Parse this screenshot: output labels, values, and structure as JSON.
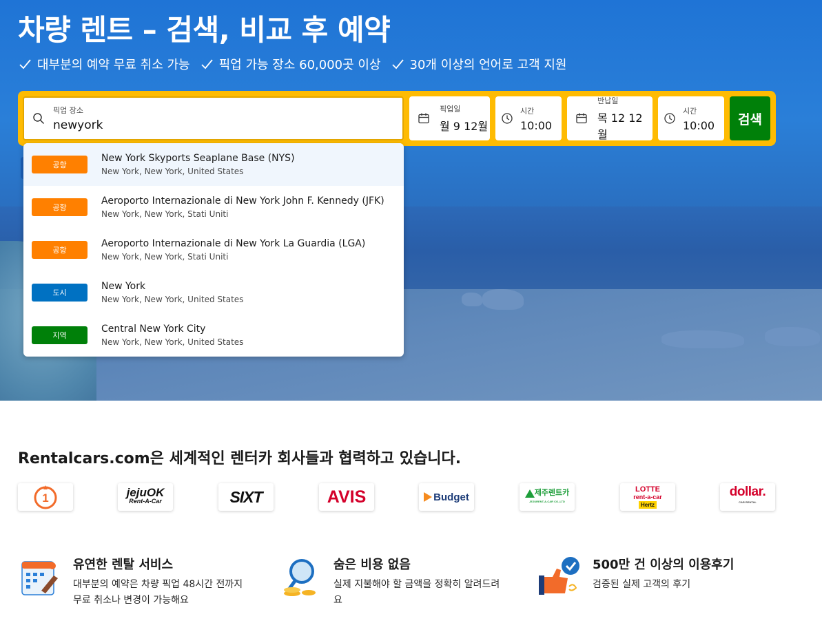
{
  "hero": {
    "title": "차량 렌트 – 검색, 비교 후 예약",
    "usps": [
      "대부분의 예약 무료 취소 가능",
      "픽업 가능 장소 60,000곳 이상",
      "30개 이상의 언어로 고객 지원"
    ]
  },
  "search": {
    "location_label": "픽업 장소",
    "location_value": "newyork",
    "pickup_date_label": "픽업일",
    "pickup_date_value": "월 9 12월",
    "pickup_time_label": "시간",
    "pickup_time_value": "10:00",
    "return_date_label": "반납일",
    "return_date_value": "목 12 12월",
    "return_time_label": "시간",
    "return_time_value": "10:00",
    "button_label": "검색"
  },
  "suggestions": [
    {
      "type": "공항",
      "color": "#ff8000",
      "name": "New York Skyports Seaplane Base (NYS)",
      "sub": "New York, New York, United States"
    },
    {
      "type": "공항",
      "color": "#ff8000",
      "name": "Aeroporto Internazionale di New York John F. Kennedy (JFK)",
      "sub": "New York, New York, Stati Uniti"
    },
    {
      "type": "공항",
      "color": "#ff8000",
      "name": "Aeroporto Internazionale di New York La Guardia (LGA)",
      "sub": "New York, New York, Stati Uniti"
    },
    {
      "type": "도시",
      "color": "#0071c2",
      "name": "New York",
      "sub": "New York, New York, United States"
    },
    {
      "type": "지역",
      "color": "#008009",
      "name": "Central New York City",
      "sub": "New York, New York, United States"
    }
  ],
  "partners": {
    "title": "Rentalcars.com은 세계적인 렌터카 회사들과 협력하고 있습니다.",
    "logos": {
      "first": "1",
      "jeju_top": "jejuOK",
      "jeju_sub": "Rent-A-Car",
      "sixt": "SIXT",
      "avis": "AVIS",
      "budget": "Budget",
      "jejurent": "제주렌트카",
      "jejurent_sub": "JEJURENT-A-CAR CO.,LTD",
      "lotte_top": "LOTTE",
      "lotte_mid": "rent-a-car",
      "lotte_hertz": "Hertz",
      "dollar": "dollar.",
      "dollar_sub": "CAR RENTAL"
    }
  },
  "features": [
    {
      "title": "유연한 렌탈 서비스",
      "desc_1": "대부분의 예약은 차량 픽업 48시간 전까지",
      "desc_2": "무료 취소나 변경이 가능해요"
    },
    {
      "title": "숨은 비용 없음",
      "desc_1": "실제 지불해야 할 금액을 정확히 알려드려",
      "desc_2": "요"
    },
    {
      "title": "500만 건 이상의 이용후기",
      "desc_1": "검증된 실제 고객의 후기",
      "desc_2": ""
    }
  ],
  "colors": {
    "brand_blue": "#2a7fd8",
    "search_yellow": "#febb02",
    "search_green": "#008009"
  }
}
